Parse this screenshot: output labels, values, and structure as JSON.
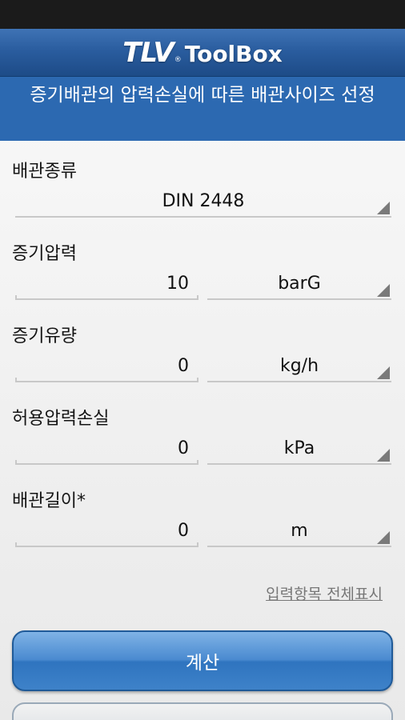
{
  "app": {
    "brand": "TLV",
    "product": "ToolBox",
    "registered": "®"
  },
  "page": {
    "title": "증기배관의 압력손실에 따른 배관사이즈 선정"
  },
  "form": {
    "pipe_type": {
      "label": "배관종류",
      "value": "DIN 2448"
    },
    "steam_pressure": {
      "label": "증기압력",
      "value": "10",
      "unit": "barG"
    },
    "steam_flow": {
      "label": "증기유량",
      "value": "0",
      "unit": "kg/h"
    },
    "allowable_pressure_loss": {
      "label": "허용압력손실",
      "value": "0",
      "unit": "kPa"
    },
    "pipe_length": {
      "label": "배관길이*",
      "value": "0",
      "unit": "m"
    },
    "show_all_link": "입력항목 전체표시"
  },
  "actions": {
    "calculate": "계산"
  },
  "colors": {
    "header": "#2a5d9f",
    "title_bar": "#2c69b1",
    "button": "#3e82c9"
  }
}
